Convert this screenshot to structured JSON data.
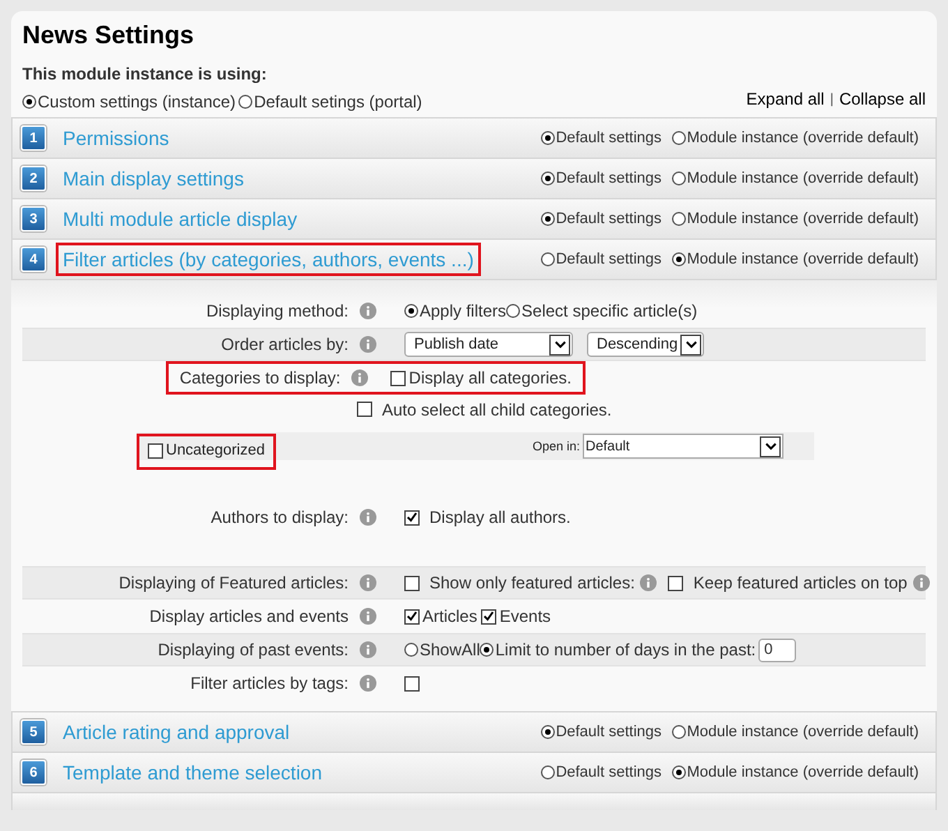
{
  "title": "News Settings",
  "using": {
    "label": "This module instance is using:",
    "options": [
      {
        "label": "Custom settings (instance)",
        "selected": true
      },
      {
        "label": "Default setings (portal)",
        "selected": false
      }
    ]
  },
  "links": {
    "expand": "Expand all",
    "separator": "|",
    "collapse": "Collapse all"
  },
  "sections_top": [
    {
      "number": "1",
      "title": "Permissions",
      "highlighted": false,
      "options": [
        {
          "label": "Default settings",
          "selected": true
        },
        {
          "label": "Module instance (override default)",
          "selected": false
        }
      ]
    },
    {
      "number": "2",
      "title": "Main display settings",
      "highlighted": false,
      "options": [
        {
          "label": "Default settings",
          "selected": true
        },
        {
          "label": "Module instance (override default)",
          "selected": false
        }
      ]
    },
    {
      "number": "3",
      "title": "Multi module article display",
      "highlighted": false,
      "options": [
        {
          "label": "Default settings",
          "selected": true
        },
        {
          "label": "Module instance (override default)",
          "selected": false
        }
      ]
    },
    {
      "number": "4",
      "title": "Filter articles (by categories, authors, events ...)",
      "highlighted": true,
      "options": [
        {
          "label": "Default settings",
          "selected": false
        },
        {
          "label": "Module instance (override default)",
          "selected": true
        }
      ]
    }
  ],
  "filter_rows": [
    {
      "kind": "radios",
      "label": "Displaying method:",
      "info": true,
      "shaded": false,
      "highlighted": false,
      "options": [
        {
          "label": "Apply filters",
          "selected": true
        },
        {
          "label": "Select specific article(s)",
          "selected": false
        }
      ]
    },
    {
      "kind": "selects",
      "label": "Order articles by:",
      "info": true,
      "shaded": true,
      "highlighted": false,
      "selects": [
        "Publish date",
        "Descending"
      ]
    },
    {
      "kind": "checks",
      "label": "Categories to display:",
      "info": true,
      "shaded": false,
      "highlighted": true,
      "checks": [
        {
          "label": "Display all categories.",
          "checked": false
        }
      ]
    },
    {
      "kind": "checks",
      "shaded": false,
      "highlighted": false,
      "checks": [
        {
          "label": "Auto select all child categories.",
          "checked": false
        }
      ]
    },
    {
      "kind": "category",
      "category": {
        "label": "Uncategorized",
        "checked": false,
        "highlighted": true
      },
      "open_label": "Open in:",
      "select": "Default"
    },
    {
      "kind": "checks",
      "label": "Authors to display:",
      "info": true,
      "shaded": false,
      "highlighted": false,
      "checks": [
        {
          "label": "Display all authors.",
          "checked": true
        }
      ]
    },
    {
      "kind": "checks",
      "label": "Displaying of Featured articles:",
      "info": true,
      "shaded": true,
      "highlighted": false,
      "checks": [
        {
          "label": "Show only featured articles:",
          "checked": false,
          "info": true
        },
        {
          "label": "Keep featured articles on top",
          "checked": false,
          "info": true
        }
      ]
    },
    {
      "kind": "checks",
      "label": "Display articles and events",
      "info": true,
      "shaded": false,
      "highlighted": false,
      "checks": [
        {
          "label": "Articles",
          "checked": true
        },
        {
          "label": "Events",
          "checked": true
        }
      ]
    },
    {
      "kind": "radios",
      "label": "Displaying of past events:",
      "info": true,
      "shaded": true,
      "highlighted": false,
      "options": [
        {
          "label": "ShowAll",
          "selected": false
        },
        {
          "label": "Limit to number of days in the past:",
          "selected": true
        }
      ],
      "input": "0"
    },
    {
      "kind": "checks",
      "label": "Filter articles by tags:",
      "info": true,
      "shaded": false,
      "highlighted": false,
      "checks": [
        {
          "checked": false
        }
      ]
    }
  ],
  "sections_bottom": [
    {
      "number": "5",
      "title": "Article rating and approval",
      "highlighted": false,
      "options": [
        {
          "label": "Default settings",
          "selected": true
        },
        {
          "label": "Module instance (override default)",
          "selected": false
        }
      ]
    },
    {
      "number": "6",
      "title": "Template and theme selection",
      "highlighted": false,
      "options": [
        {
          "label": "Default settings",
          "selected": false
        },
        {
          "label": "Module instance (override default)",
          "selected": true
        }
      ]
    }
  ]
}
